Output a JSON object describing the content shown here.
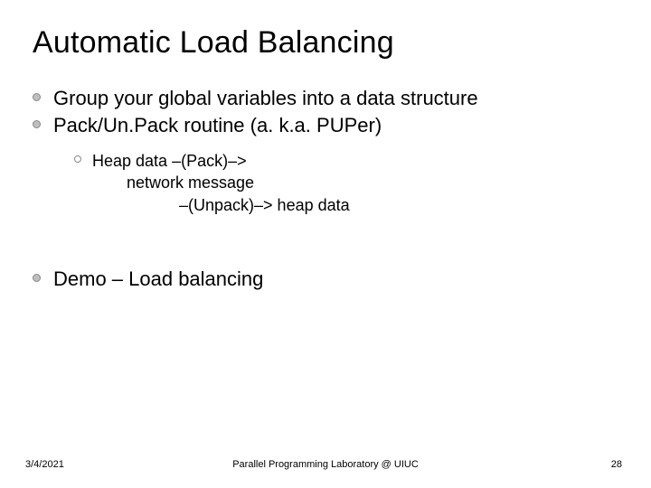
{
  "title": "Automatic Load Balancing",
  "bullets": {
    "b1": "Group your global variables into a data structure",
    "b2": "Pack/Un.Pack routine (a. k.a. PUPer)",
    "sub": {
      "line1": "Heap data –(Pack)–>",
      "line2": "network message",
      "line3": "–(Unpack)–> heap data"
    },
    "b3": "Demo – Load balancing"
  },
  "footer": {
    "date": "3/4/2021",
    "center": "Parallel Programming Laboratory @ UIUC",
    "page": "28"
  }
}
